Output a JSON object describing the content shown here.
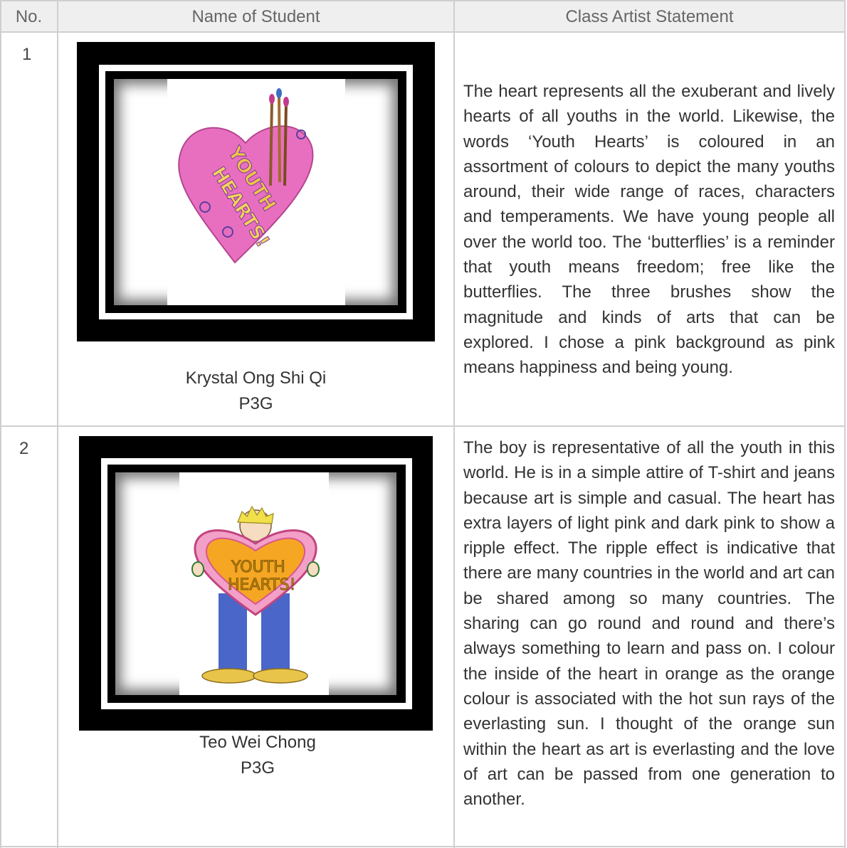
{
  "header": {
    "col_no": "No.",
    "col_name": "Name of Student",
    "col_statement": "Class Artist Statement"
  },
  "rows": [
    {
      "no": "1",
      "artwork_icon": "heart-drawing",
      "artwork_text": "YOUTH HEARTS!",
      "student_name": "Krystal Ong Shi Qi",
      "student_class": "P3G",
      "statement": "The heart represents all the exuberant and lively hearts of all youths in the world. Likewise, the words ‘Youth Hearts’ is coloured in an assortment of colours to depict the many youths around, their wide range of races, characters and temperaments. We have young people all over the world too. The ‘butterflies’ is a reminder that youth means freedom; free like the butterflies. The three brushes show the magnitude and kinds of arts that can be explored. I chose a pink background as pink means happiness and being young."
    },
    {
      "no": "2",
      "artwork_icon": "boy-holding-heart-drawing",
      "artwork_text": "YOUTH HEARTS!",
      "student_name": "Teo Wei Chong",
      "student_class": "P3G",
      "statement": "The boy is representative of all the youth in this world. He is in a simple attire of T-shirt and jeans because art is simple and casual. The heart has extra layers of light pink and dark pink to show a ripple effect. The ripple effect is indicative that there are many countries in the world and art can be shared among so many countries. The sharing can go round and round and there’s always something to learn and pass on. I colour the inside of the heart in orange as the orange colour is associated with the hot sun rays of the everlasting sun. I thought of the orange sun within the heart as art is everlasting and the love of art can be passed from one generation to another."
    }
  ],
  "colors": {
    "border": "#cfcfcf",
    "header_bg": "#efefef",
    "frame": "#000000",
    "heart_pink": "#e86fc0",
    "heart_orange": "#f5a623"
  }
}
